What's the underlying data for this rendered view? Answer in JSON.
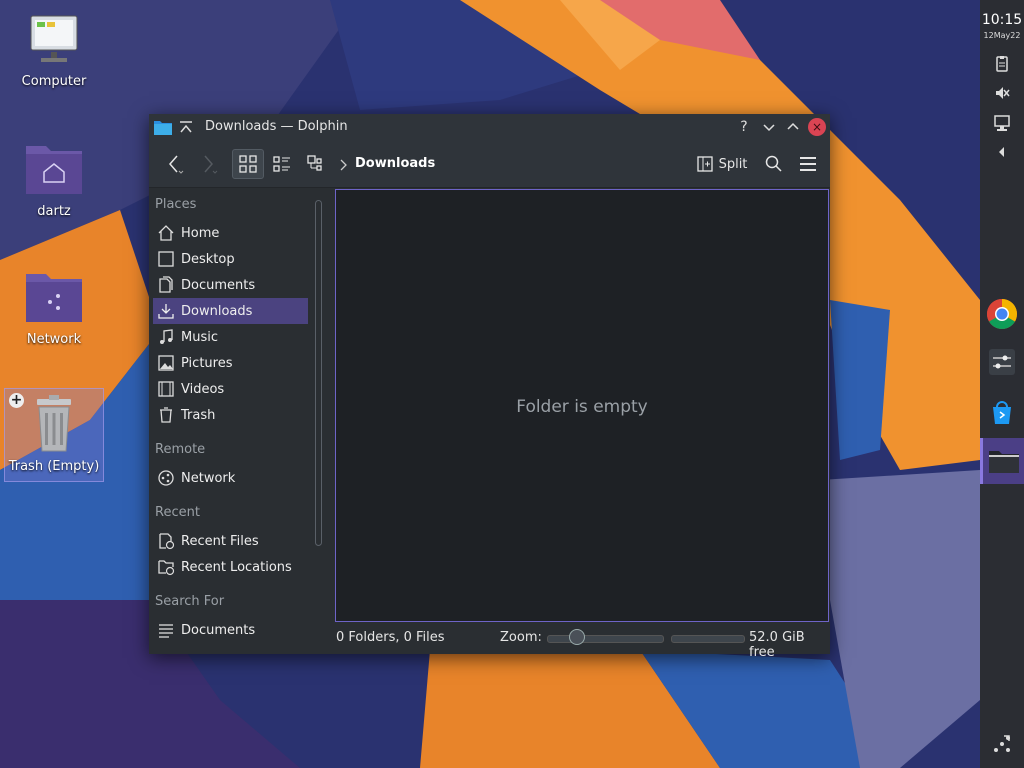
{
  "desktop": {
    "icons": [
      {
        "label": "Computer"
      },
      {
        "label": "dartz"
      },
      {
        "label": "Network"
      },
      {
        "label": "Trash (Empty)"
      }
    ]
  },
  "panel": {
    "time": "10:15",
    "date": "12May22",
    "tray_icons": [
      "clipboard-icon",
      "volume-muted-icon",
      "network-wired-icon",
      "expand-tray-icon"
    ],
    "tasks": [
      "chrome-icon",
      "settings-icon",
      "discover-store-icon",
      "dolphin-folder-icon"
    ],
    "bottom_icon": "application-launcher-icon"
  },
  "window": {
    "title": "Downloads — Dolphin",
    "titlebar_buttons": {
      "help": "?",
      "minimize": "⌄",
      "maximize": "⌃",
      "close": "×"
    },
    "toolbar": {
      "breadcrumb": "Downloads",
      "split_label": "Split"
    },
    "sidebar": {
      "sections": [
        {
          "title": "Places",
          "items": [
            {
              "label": "Home",
              "icon": "home-icon"
            },
            {
              "label": "Desktop",
              "icon": "desktop-icon"
            },
            {
              "label": "Documents",
              "icon": "documents-icon"
            },
            {
              "label": "Downloads",
              "icon": "downloads-icon",
              "active": true
            },
            {
              "label": "Music",
              "icon": "music-icon"
            },
            {
              "label": "Pictures",
              "icon": "pictures-icon"
            },
            {
              "label": "Videos",
              "icon": "videos-icon"
            },
            {
              "label": "Trash",
              "icon": "trash-icon"
            }
          ]
        },
        {
          "title": "Remote",
          "items": [
            {
              "label": "Network",
              "icon": "network-icon"
            }
          ]
        },
        {
          "title": "Recent",
          "items": [
            {
              "label": "Recent Files",
              "icon": "recent-files-icon"
            },
            {
              "label": "Recent Locations",
              "icon": "recent-locations-icon"
            }
          ]
        },
        {
          "title": "Search For",
          "items": [
            {
              "label": "Documents",
              "icon": "search-documents-icon"
            }
          ]
        }
      ]
    },
    "content": {
      "empty_message": "Folder is empty"
    },
    "statusbar": {
      "summary": "0 Folders, 0 Files",
      "zoom_label": "Zoom:",
      "free_space": "52.0 GiB free"
    }
  },
  "colors": {
    "accent": "#8a79e0",
    "selection": "#4b4380",
    "close_button": "#da4453"
  }
}
